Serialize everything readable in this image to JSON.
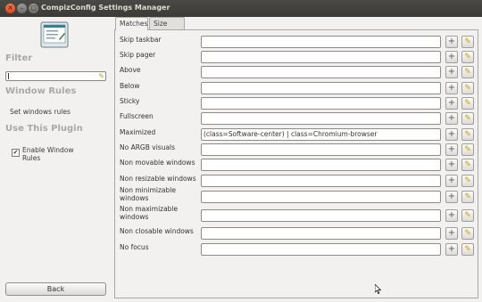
{
  "window": {
    "title": "CompizConfig Settings Manager"
  },
  "sidebar": {
    "filter_heading": "Filter",
    "filter_value": "",
    "section_heading": "Window Rules",
    "section_link": "Set windows rules",
    "use_heading": "Use This Plugin",
    "enable_label": "Enable Window Rules",
    "enable_checked": true,
    "back_label": "Back"
  },
  "tabs": [
    {
      "label": "Matches",
      "active": true
    },
    {
      "label": "Size rules",
      "active": false
    }
  ],
  "rules": [
    {
      "label": "Skip taskbar",
      "value": ""
    },
    {
      "label": "Skip pager",
      "value": ""
    },
    {
      "label": "Above",
      "value": ""
    },
    {
      "label": "Below",
      "value": ""
    },
    {
      "label": "Sticky",
      "value": ""
    },
    {
      "label": "Fullscreen",
      "value": ""
    },
    {
      "label": "Maximized",
      "value": "(class=Software-center) | class=Chromium-browser"
    },
    {
      "label": "No ARGB visuals",
      "value": ""
    },
    {
      "label": "Non movable windows",
      "value": ""
    },
    {
      "label": "Non resizable windows",
      "value": ""
    },
    {
      "label": "Non minimizable windows",
      "value": ""
    },
    {
      "label": "Non maximizable windows",
      "value": ""
    },
    {
      "label": "Non closable windows",
      "value": ""
    },
    {
      "label": "No focus",
      "value": ""
    }
  ],
  "icons": {
    "add": "plus-icon",
    "clear": "broom-icon",
    "close": "close-icon",
    "minimize": "minimize-icon",
    "maximize": "maximize-icon"
  },
  "colors": {
    "titlebar": "#3b3a36",
    "close_button": "#e2581f",
    "window_bg": "#f2f1f0",
    "heading": "#a9a9a4"
  }
}
